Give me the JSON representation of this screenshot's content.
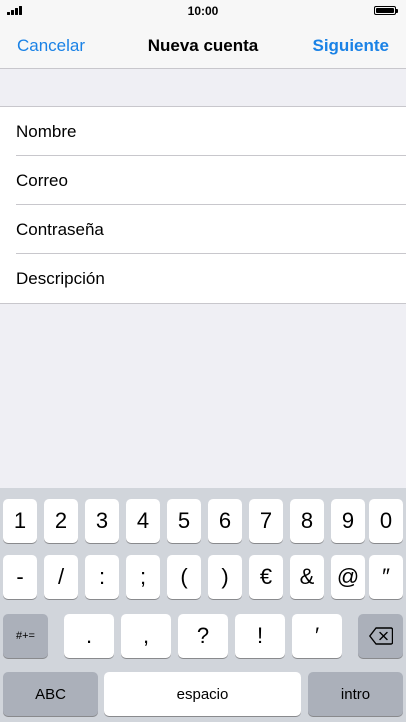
{
  "status_bar": {
    "time": "10:00"
  },
  "nav": {
    "cancel": "Cancelar",
    "title": "Nueva cuenta",
    "next": "Siguiente",
    "accent_color": "#1a82e6"
  },
  "form": {
    "fields": [
      {
        "placeholder": "Nombre"
      },
      {
        "placeholder": "Correo"
      },
      {
        "placeholder": "Contraseña"
      },
      {
        "placeholder": "Descripción"
      }
    ]
  },
  "keyboard": {
    "row1": [
      "1",
      "2",
      "3",
      "4",
      "5",
      "6",
      "7",
      "8",
      "9",
      "0"
    ],
    "row2": [
      "-",
      "/",
      ":",
      ";",
      "(",
      ")",
      "€",
      "&",
      "@",
      "″"
    ],
    "row3": [
      ".",
      ",",
      "?",
      "!",
      "′"
    ],
    "symbols_key": "#+=",
    "delete_icon": "backspace-icon",
    "abc_key": "ABC",
    "space_key": "espacio",
    "return_key": "intro"
  }
}
